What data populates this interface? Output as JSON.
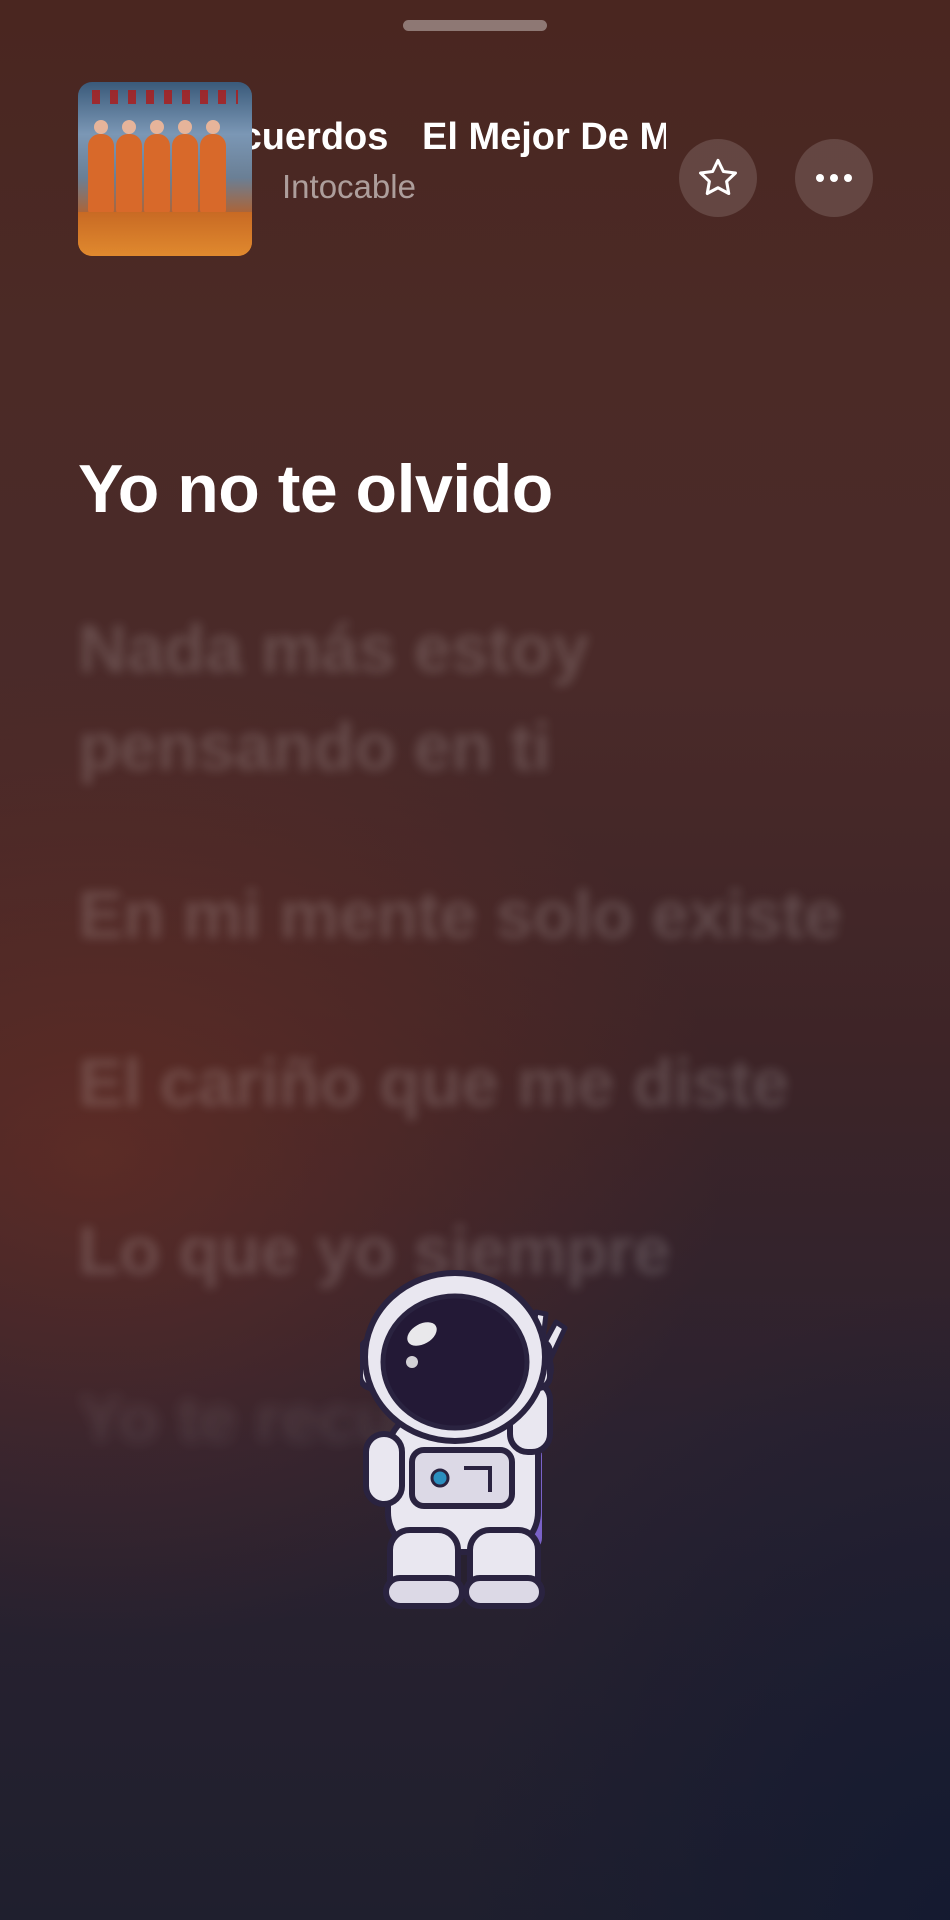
{
  "now_playing": {
    "title_scroll_segment_1": "Recuerdos",
    "title_scroll_segment_2": "El Mejor De Mi",
    "artist": "Intocable"
  },
  "icons": {
    "favorite": "star-icon",
    "more": "ellipsis-icon",
    "handle": "grabber-handle",
    "sticker": "astronaut-sticker"
  },
  "lyrics": {
    "current": "Yo no te olvido",
    "lines": [
      "Nada más estoy pensando en ti",
      "En mi mente solo existe",
      "El cariño que me diste",
      "Lo que yo siempre",
      "Yo te recuerdo"
    ]
  },
  "colors": {
    "background_top": "#4a2620",
    "background_bottom": "#1f1f2e",
    "text_active": "#ffffff"
  }
}
